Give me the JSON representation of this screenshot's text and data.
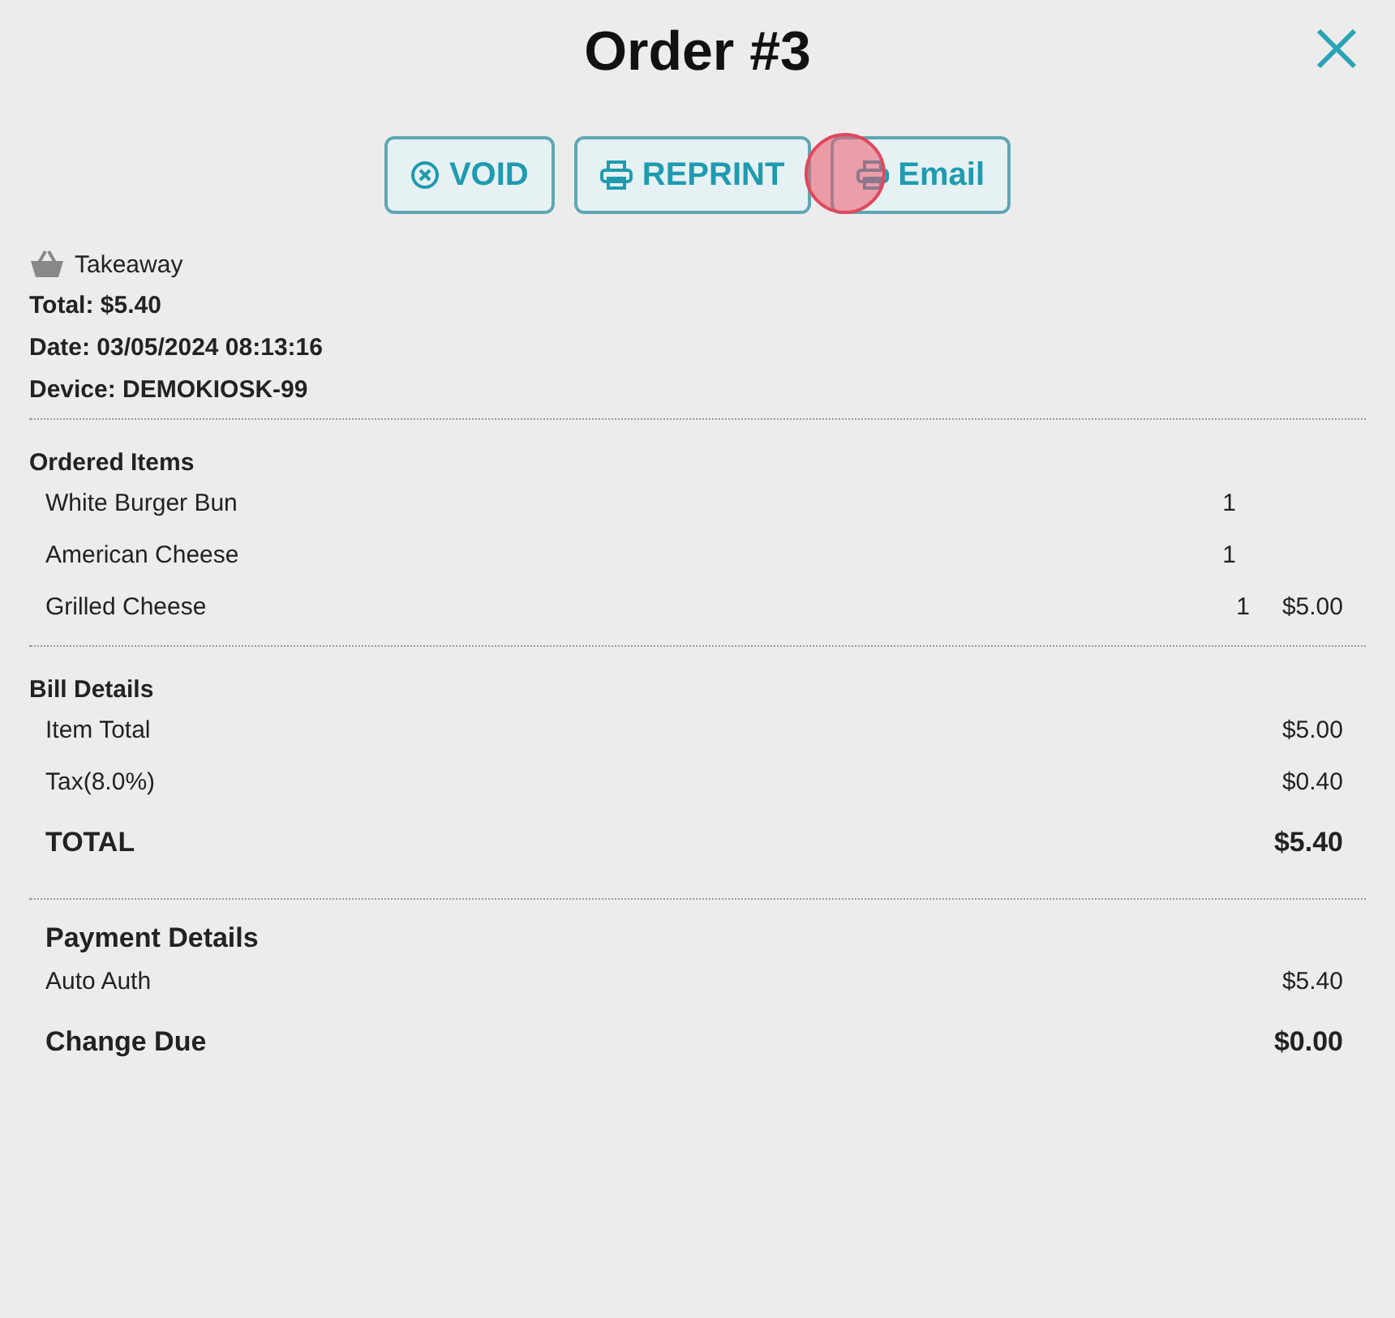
{
  "title": "Order #3",
  "actions": [
    {
      "label": "VOID",
      "kind": "void"
    },
    {
      "label": "REPRINT",
      "kind": "print"
    },
    {
      "label": "Email",
      "kind": "print"
    }
  ],
  "order_type": "Takeaway",
  "info": [
    "Total: $5.40",
    "Date: 03/05/2024 08:13:16",
    "Device: DEMOKIOSK-99"
  ],
  "ordered_items": {
    "heading": "Ordered Items",
    "rows": [
      {
        "name": "White Burger Bun",
        "qty": "1"
      },
      {
        "name": "American Cheese",
        "qty": "1"
      },
      {
        "name": "Grilled Cheese",
        "qty": "1",
        "price": "$5.00"
      }
    ]
  },
  "bill_details": {
    "heading": "Bill Details",
    "rows": [
      {
        "label": "Item Total",
        "amount": "$5.00",
        "kind": "line"
      },
      {
        "label": "Tax(8.0%)",
        "amount": "$0.40",
        "kind": "line"
      },
      {
        "label": "TOTAL",
        "amount": "$5.40",
        "kind": "total"
      }
    ]
  },
  "payment_details": {
    "heading": "Payment Details",
    "rows": [
      {
        "label": "Auto Auth",
        "amount": "$5.40",
        "kind": "line"
      },
      {
        "label": "Change Due",
        "amount": "$0.00",
        "kind": "total"
      }
    ]
  }
}
